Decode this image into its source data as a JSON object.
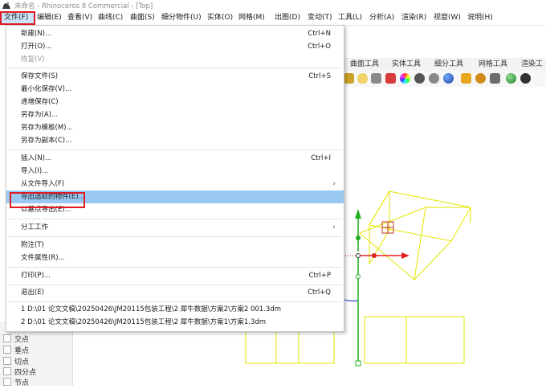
{
  "window": {
    "title": "未命名 - Rhinoceros 8 Commercial - [Top]"
  },
  "menubar": [
    {
      "label": "文件(F)"
    },
    {
      "label": "编辑(E)"
    },
    {
      "label": "查看(V)"
    },
    {
      "label": "曲线(C)"
    },
    {
      "label": "曲面(S)"
    },
    {
      "label": "细分物件(U)"
    },
    {
      "label": "实体(O)"
    },
    {
      "label": "网格(M)"
    },
    {
      "label": "出图(D)"
    },
    {
      "label": "变动(T)"
    },
    {
      "label": "工具(L)"
    },
    {
      "label": "分析(A)"
    },
    {
      "label": "渲染(R)"
    },
    {
      "label": "视窗(W)"
    },
    {
      "label": "说明(H)"
    }
  ],
  "tabs": [
    {
      "label": "曲面工具"
    },
    {
      "label": "实体工具"
    },
    {
      "label": "细分工具"
    },
    {
      "label": "网格工具"
    },
    {
      "label": "渲染工"
    }
  ],
  "toolbar_icons": [
    {
      "name": "lock-icon",
      "color": "#c9a227"
    },
    {
      "name": "light-bulb-icon",
      "color": "#f0d36a"
    },
    {
      "name": "spotlight-icon",
      "color": "#8a8a8a"
    },
    {
      "name": "material-icon",
      "color": "#d83b3b"
    },
    {
      "name": "color-wheel-icon",
      "color": "#b64fc8"
    },
    {
      "name": "sphere-render-icon",
      "color": "#555555"
    },
    {
      "name": "environment-icon",
      "color": "#888888"
    },
    {
      "name": "globe-icon",
      "color": "#1f5fbf"
    },
    {
      "name": "decal-icon",
      "color": "#e9a820"
    },
    {
      "name": "settings-gear-icon",
      "color": "#d18b1d"
    },
    {
      "name": "texture-icon",
      "color": "#6c6c6c"
    },
    {
      "name": "render-globe-icon",
      "color": "#2e9b3f"
    },
    {
      "name": "ground-plane-icon",
      "color": "#333333"
    }
  ],
  "file_menu": {
    "items": [
      {
        "label": "新建(N)...",
        "shortcut": "Ctrl+N"
      },
      {
        "label": "打开(O)...",
        "shortcut": "Ctrl+O"
      },
      {
        "label": "恢复(V)",
        "shortcut": ""
      },
      {
        "label": "保存文件(S)",
        "shortcut": "Ctrl+S"
      },
      {
        "label": "最小化保存(V)...",
        "shortcut": ""
      },
      {
        "label": "递增保存(C)",
        "shortcut": ""
      },
      {
        "label": "另存为(A)...",
        "shortcut": ""
      },
      {
        "label": "另存为模板(M)...",
        "shortcut": ""
      },
      {
        "label": "另存为副本(C)...",
        "shortcut": ""
      },
      {
        "label": "插入(N)...",
        "shortcut": "Ctrl+I"
      },
      {
        "label": "导入(I)...",
        "shortcut": ""
      },
      {
        "label": "从文件导入(F)",
        "shortcut": ""
      },
      {
        "label": "导出选取的物件(E)...",
        "shortcut": ""
      },
      {
        "label": "以基点导出(E)...",
        "shortcut": ""
      },
      {
        "label": "分工工作",
        "shortcut": ""
      },
      {
        "label": "附注(T)",
        "shortcut": ""
      },
      {
        "label": "文件属性(R)...",
        "shortcut": ""
      },
      {
        "label": "打印(P)...",
        "shortcut": "Ctrl+P"
      },
      {
        "label": "退出(E)",
        "shortcut": "Ctrl+Q"
      },
      {
        "label": "1 D:\\01 论文文稿\\20250426\\JM20115包装工程\\2 犀牛数据\\方案2\\方案2 001.3dm",
        "shortcut": ""
      },
      {
        "label": "2 D:\\01 论文文稿\\20250426\\JM20115包装工程\\2 犀牛数据\\方案1\\方案1.3dm",
        "shortcut": ""
      }
    ]
  },
  "osnap_panel": {
    "items": [
      {
        "label": "交点"
      },
      {
        "label": "垂点"
      },
      {
        "label": "切点"
      },
      {
        "label": "四分点"
      },
      {
        "label": "节点"
      }
    ]
  },
  "colors": {
    "highlight": "#99c9f1",
    "annotation_red": "#e01b24",
    "selected_geometry": "#e6e600",
    "x_axis": "#e02020",
    "y_axis": "#20b020"
  }
}
